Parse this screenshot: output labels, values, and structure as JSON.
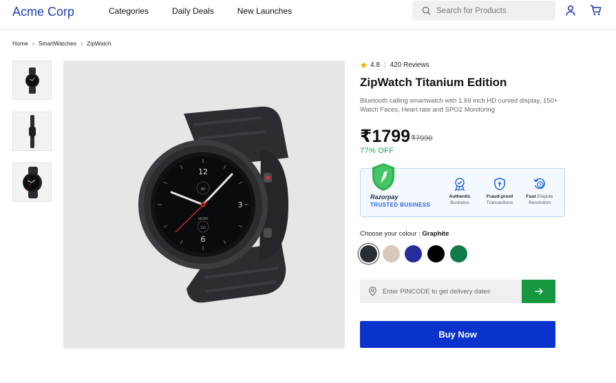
{
  "header": {
    "brand": "Acme Corp",
    "nav": [
      "Categories",
      "Daily Deals",
      "New Launches"
    ],
    "search_placeholder": "Search for Products"
  },
  "breadcrumb": [
    "Home",
    "SmartWatches",
    "ZipWatch"
  ],
  "product": {
    "rating": "4.8",
    "reviews": "420 Reviews",
    "title": "ZipWatch Titanium Edition",
    "description": "Bluetooth calling smartwatch with 1.69 inch HD curved display, 150+ Watch Faces, Heart rate and SPO2 Monitoring",
    "price": "₹1799",
    "mrp": "₹7990",
    "discount": "77% OFF"
  },
  "watch_face": {
    "top_number": "12",
    "right_number": "3",
    "bottom_number": "6",
    "top_value": "80",
    "label": "HEART",
    "bottom_value": "152"
  },
  "trust": {
    "brand": "Razorpay",
    "tagline": "TRUSTED BUSINESS",
    "features": [
      {
        "bold": "Authentic",
        "rest": "Business",
        "icon": "rosette-check-icon"
      },
      {
        "bold": "Fraud-proof",
        "rest": "Transactions",
        "icon": "shield-lock-icon"
      },
      {
        "bold": "Fast",
        "rest": "Dispute Resolution",
        "icon": "history-icon"
      }
    ]
  },
  "colour": {
    "label": "Choose your colour :",
    "selected": "Graphite",
    "swatches": [
      "#2b2e33",
      "#d8c8bb",
      "#252c9c",
      "#000000",
      "#117a48"
    ]
  },
  "pincode": {
    "placeholder": "Enter PINCODE to get delivery dates"
  },
  "buy_label": "Buy Now",
  "colors": {
    "brand": "#1f3fb5",
    "buy": "#0a32cc",
    "green": "#15963f",
    "discount": "#16a34a"
  }
}
